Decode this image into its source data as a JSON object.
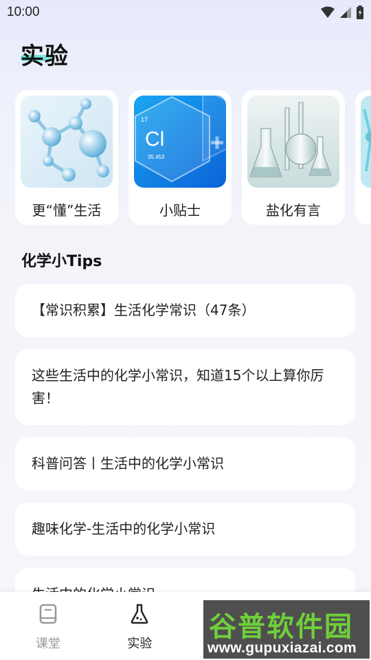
{
  "status_bar": {
    "time": "10:00"
  },
  "page": {
    "title": "实验"
  },
  "cards": [
    {
      "label": "更“懂”生活",
      "icon": "molecule-image"
    },
    {
      "label": "小贴士",
      "icon": "chlorine-element-image",
      "element_number": "17",
      "element_symbol": "Cl",
      "element_mass": "35.453"
    },
    {
      "label": "盐化有言",
      "icon": "flasks-image"
    },
    {
      "label": "",
      "icon": "partial-card-image"
    }
  ],
  "section": {
    "title": "化学小Tips"
  },
  "tips": [
    "【常识积累】生活化学常识（47条）",
    "这些生活中的化学小常识，知道15个以上算你厉害！",
    "科普问答丨生活中的化学小常识",
    "趣味化学-生活中的化学小常识",
    "生活中的化学小常识"
  ],
  "tab_bar": {
    "tabs": [
      {
        "label": "课堂",
        "icon": "book-icon",
        "active": false
      },
      {
        "label": "实验",
        "icon": "flask-icon",
        "active": true
      },
      {
        "label": "",
        "icon": "tab-icon-3",
        "active": false
      },
      {
        "label": "",
        "icon": "tab-icon-4",
        "active": false
      }
    ]
  },
  "watermark": {
    "title": "谷普软件园",
    "url": "www.gupuxiazai.com"
  },
  "colors": {
    "accent": "#39d9c8",
    "background": "#f4f5fa",
    "watermark_green": "#6fcf3a"
  }
}
